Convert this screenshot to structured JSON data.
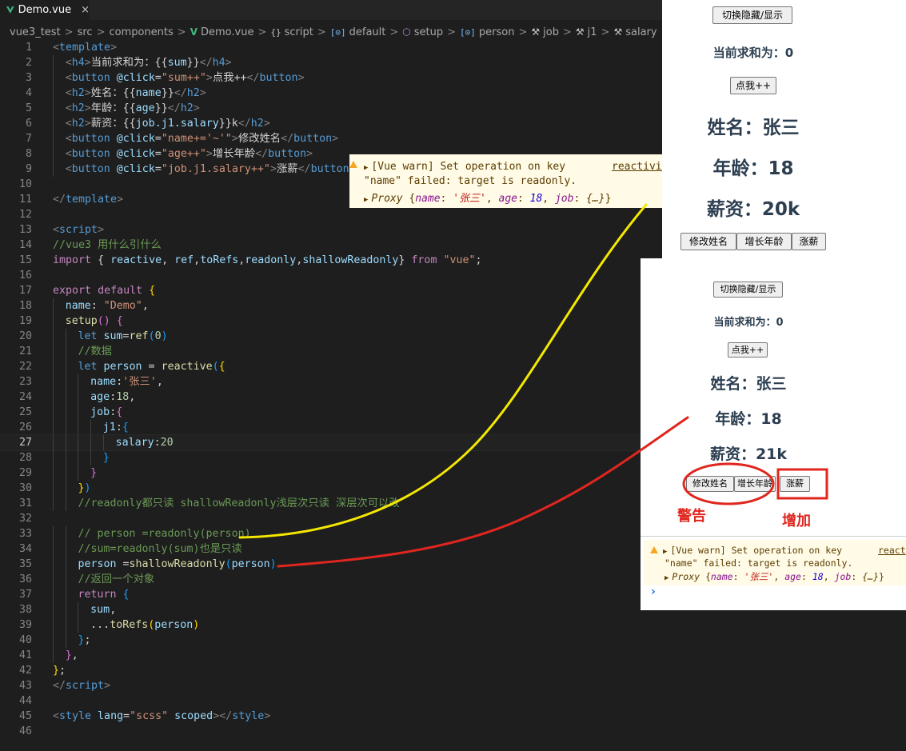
{
  "tab": {
    "label": "Demo.vue",
    "close": "×"
  },
  "breadcrumb": {
    "items": [
      {
        "label": "vue3_test",
        "icon": ""
      },
      {
        "label": "src",
        "icon": ""
      },
      {
        "label": "components",
        "icon": ""
      },
      {
        "label": "Demo.vue",
        "icon": "vue-icon"
      },
      {
        "label": "script",
        "icon": "braces-icon"
      },
      {
        "label": "default",
        "icon": "object-icon"
      },
      {
        "label": "setup",
        "icon": "method-icon"
      },
      {
        "label": "person",
        "icon": "object-icon"
      },
      {
        "label": "job",
        "icon": "wrench-icon"
      },
      {
        "label": "j1",
        "icon": "wrench-icon"
      },
      {
        "label": "salary",
        "icon": "wrench-icon"
      }
    ],
    "separator": ">"
  },
  "editor": {
    "current_line": 27,
    "lines": [
      {
        "n": "1",
        "indent": 1,
        "t": [
          [
            "<",
            "br"
          ],
          [
            "template",
            "tag"
          ],
          [
            ">",
            "br"
          ]
        ]
      },
      {
        "n": "2",
        "indent": 2,
        "t": [
          [
            "<",
            "br"
          ],
          [
            "h4",
            "tag"
          ],
          [
            ">",
            "br"
          ],
          [
            "当前求和为：",
            "txt"
          ],
          [
            "{{",
            "txt"
          ],
          [
            "sum",
            "var"
          ],
          [
            "}}",
            "txt"
          ],
          [
            "</",
            "br"
          ],
          [
            "h4",
            "tag"
          ],
          [
            ">",
            "br"
          ]
        ]
      },
      {
        "n": "3",
        "indent": 2,
        "t": [
          [
            "<",
            "br"
          ],
          [
            "button",
            "tag"
          ],
          [
            " @click",
            "attr"
          ],
          [
            "=",
            "txt"
          ],
          [
            "\"sum++\"",
            "str"
          ],
          [
            ">",
            "br"
          ],
          [
            "点我++",
            "txt"
          ],
          [
            "</",
            "br"
          ],
          [
            "button",
            "tag"
          ],
          [
            ">",
            "br"
          ]
        ]
      },
      {
        "n": "4",
        "indent": 2,
        "t": [
          [
            "<",
            "br"
          ],
          [
            "h2",
            "tag"
          ],
          [
            ">",
            "br"
          ],
          [
            "姓名：",
            "txt"
          ],
          [
            "{{",
            "txt"
          ],
          [
            "name",
            "var"
          ],
          [
            "}}",
            "txt"
          ],
          [
            "</",
            "br"
          ],
          [
            "h2",
            "tag"
          ],
          [
            ">",
            "br"
          ]
        ]
      },
      {
        "n": "5",
        "indent": 2,
        "t": [
          [
            "<",
            "br"
          ],
          [
            "h2",
            "tag"
          ],
          [
            ">",
            "br"
          ],
          [
            "年龄：",
            "txt"
          ],
          [
            "{{",
            "txt"
          ],
          [
            "age",
            "var"
          ],
          [
            "}}",
            "txt"
          ],
          [
            "</",
            "br"
          ],
          [
            "h2",
            "tag"
          ],
          [
            ">",
            "br"
          ]
        ]
      },
      {
        "n": "6",
        "indent": 2,
        "t": [
          [
            "<",
            "br"
          ],
          [
            "h2",
            "tag"
          ],
          [
            ">",
            "br"
          ],
          [
            "薪资：",
            "txt"
          ],
          [
            "{{",
            "txt"
          ],
          [
            "job.j1.salary",
            "var"
          ],
          [
            "}}",
            "txt"
          ],
          [
            "k",
            "txt"
          ],
          [
            "</",
            "br"
          ],
          [
            "h2",
            "tag"
          ],
          [
            ">",
            "br"
          ]
        ]
      },
      {
        "n": "7",
        "indent": 2,
        "t": [
          [
            "<",
            "br"
          ],
          [
            "button",
            "tag"
          ],
          [
            " @click",
            "attr"
          ],
          [
            "=",
            "txt"
          ],
          [
            "\"name+='~'\"",
            "str"
          ],
          [
            ">",
            "br"
          ],
          [
            "修改姓名",
            "txt"
          ],
          [
            "</",
            "br"
          ],
          [
            "button",
            "tag"
          ],
          [
            ">",
            "br"
          ]
        ]
      },
      {
        "n": "8",
        "indent": 2,
        "t": [
          [
            "<",
            "br"
          ],
          [
            "button",
            "tag"
          ],
          [
            " @click",
            "attr"
          ],
          [
            "=",
            "txt"
          ],
          [
            "\"age++\"",
            "str"
          ],
          [
            ">",
            "br"
          ],
          [
            "增长年龄",
            "txt"
          ],
          [
            "</",
            "br"
          ],
          [
            "button",
            "tag"
          ],
          [
            ">",
            "br"
          ]
        ]
      },
      {
        "n": "9",
        "indent": 2,
        "t": [
          [
            "<",
            "br"
          ],
          [
            "button",
            "tag"
          ],
          [
            " @click",
            "attr"
          ],
          [
            "=",
            "txt"
          ],
          [
            "\"job.j1.salary++\"",
            "str"
          ],
          [
            ">",
            "br"
          ],
          [
            "涨薪",
            "txt"
          ],
          [
            "</",
            "br"
          ],
          [
            "button",
            "tag"
          ],
          [
            ">",
            "br"
          ]
        ]
      },
      {
        "n": "10",
        "indent": 0,
        "t": []
      },
      {
        "n": "11",
        "indent": 1,
        "t": [
          [
            "</",
            "br"
          ],
          [
            "template",
            "tag"
          ],
          [
            ">",
            "br"
          ]
        ]
      },
      {
        "n": "12",
        "indent": 0,
        "t": []
      },
      {
        "n": "13",
        "indent": 1,
        "t": [
          [
            "<",
            "br"
          ],
          [
            "script",
            "tag"
          ],
          [
            ">",
            "br"
          ]
        ]
      },
      {
        "n": "14",
        "indent": 1,
        "t": [
          [
            "//vue3 用什么引什么",
            "com"
          ]
        ]
      },
      {
        "n": "15",
        "indent": 1,
        "t": [
          [
            "import",
            "kw"
          ],
          [
            " { ",
            "txt"
          ],
          [
            "reactive",
            "var"
          ],
          [
            ", ",
            "txt"
          ],
          [
            "ref",
            "var"
          ],
          [
            ",",
            "txt"
          ],
          [
            "toRefs",
            "var"
          ],
          [
            ",",
            "txt"
          ],
          [
            "readonly",
            "var"
          ],
          [
            ",",
            "txt"
          ],
          [
            "shallowReadonly",
            "var"
          ],
          [
            "} ",
            "txt"
          ],
          [
            "from",
            "kw"
          ],
          [
            " ",
            "txt"
          ],
          [
            "\"vue\"",
            "str"
          ],
          [
            ";",
            "txt"
          ]
        ]
      },
      {
        "n": "16",
        "indent": 0,
        "t": []
      },
      {
        "n": "17",
        "indent": 1,
        "t": [
          [
            "export",
            "kw"
          ],
          [
            " ",
            "txt"
          ],
          [
            "default",
            "kw"
          ],
          [
            " ",
            "txt"
          ],
          [
            "{",
            "y"
          ]
        ]
      },
      {
        "n": "18",
        "indent": 2,
        "t": [
          [
            "name",
            "var"
          ],
          [
            ": ",
            "txt"
          ],
          [
            "\"Demo\"",
            "str"
          ],
          [
            ",",
            "txt"
          ]
        ]
      },
      {
        "n": "19",
        "indent": 2,
        "t": [
          [
            "setup",
            "fn"
          ],
          [
            "() ",
            "p"
          ],
          [
            "{",
            "p"
          ]
        ]
      },
      {
        "n": "20",
        "indent": 3,
        "t": [
          [
            "let",
            "kw2"
          ],
          [
            " ",
            "txt"
          ],
          [
            "sum",
            "var"
          ],
          [
            "=",
            "txt"
          ],
          [
            "ref",
            "fn"
          ],
          [
            "(",
            "b"
          ],
          [
            "0",
            "num"
          ],
          [
            ")",
            "b"
          ]
        ]
      },
      {
        "n": "21",
        "indent": 3,
        "t": [
          [
            "//数据",
            "com"
          ]
        ]
      },
      {
        "n": "22",
        "indent": 3,
        "t": [
          [
            "let",
            "kw2"
          ],
          [
            " ",
            "txt"
          ],
          [
            "person",
            "var"
          ],
          [
            " = ",
            "txt"
          ],
          [
            "reactive",
            "fn"
          ],
          [
            "(",
            "b"
          ],
          [
            "{",
            "y"
          ]
        ]
      },
      {
        "n": "23",
        "indent": 4,
        "t": [
          [
            "name",
            "var"
          ],
          [
            ":",
            "txt"
          ],
          [
            "'张三'",
            "str"
          ],
          [
            ",",
            "txt"
          ]
        ]
      },
      {
        "n": "24",
        "indent": 4,
        "t": [
          [
            "age",
            "var"
          ],
          [
            ":",
            "txt"
          ],
          [
            "18",
            "num"
          ],
          [
            ",",
            "txt"
          ]
        ]
      },
      {
        "n": "25",
        "indent": 4,
        "t": [
          [
            "job",
            "var"
          ],
          [
            ":",
            "txt"
          ],
          [
            "{",
            "p"
          ]
        ]
      },
      {
        "n": "26",
        "indent": 5,
        "t": [
          [
            "j1",
            "var"
          ],
          [
            ":",
            "txt"
          ],
          [
            "{",
            "b"
          ]
        ]
      },
      {
        "n": "27",
        "indent": 6,
        "t": [
          [
            "salary",
            "var"
          ],
          [
            ":",
            "txt"
          ],
          [
            "20",
            "num"
          ]
        ]
      },
      {
        "n": "28",
        "indent": 5,
        "t": [
          [
            "}",
            "b"
          ]
        ]
      },
      {
        "n": "29",
        "indent": 4,
        "t": [
          [
            "}",
            "p"
          ]
        ]
      },
      {
        "n": "30",
        "indent": 3,
        "t": [
          [
            "}",
            "y"
          ],
          [
            ")",
            "b"
          ]
        ]
      },
      {
        "n": "31",
        "indent": 3,
        "t": [
          [
            "//readonly都只读 shallowReadonly浅层次只读 深层次可以改",
            "com"
          ]
        ]
      },
      {
        "n": "32",
        "indent": 0,
        "t": []
      },
      {
        "n": "33",
        "indent": 3,
        "t": [
          [
            "// person =readonly(person)",
            "com"
          ]
        ]
      },
      {
        "n": "34",
        "indent": 3,
        "t": [
          [
            "//sum=readonly(sum)也是只读",
            "com"
          ]
        ]
      },
      {
        "n": "35",
        "indent": 3,
        "t": [
          [
            "person",
            "var"
          ],
          [
            " =",
            "txt"
          ],
          [
            "shallowReadonly",
            "fn"
          ],
          [
            "(",
            "b"
          ],
          [
            "person",
            "var"
          ],
          [
            ")",
            "b"
          ]
        ]
      },
      {
        "n": "36",
        "indent": 3,
        "t": [
          [
            "//返回一个对象",
            "com"
          ]
        ]
      },
      {
        "n": "37",
        "indent": 3,
        "t": [
          [
            "return",
            "kw"
          ],
          [
            " ",
            "txt"
          ],
          [
            "{",
            "b"
          ]
        ]
      },
      {
        "n": "38",
        "indent": 4,
        "t": [
          [
            "sum",
            "var"
          ],
          [
            ",",
            "txt"
          ]
        ]
      },
      {
        "n": "39",
        "indent": 4,
        "t": [
          [
            "...",
            "txt"
          ],
          [
            "toRefs",
            "fn"
          ],
          [
            "(",
            "y"
          ],
          [
            "person",
            "var"
          ],
          [
            ")",
            "y"
          ]
        ]
      },
      {
        "n": "40",
        "indent": 3,
        "t": [
          [
            "}",
            "b"
          ],
          [
            ";",
            "txt"
          ]
        ]
      },
      {
        "n": "41",
        "indent": 2,
        "t": [
          [
            "}",
            "p"
          ],
          [
            ",",
            "txt"
          ]
        ]
      },
      {
        "n": "42",
        "indent": 1,
        "t": [
          [
            "}",
            "y"
          ],
          [
            ";",
            "txt"
          ]
        ]
      },
      {
        "n": "43",
        "indent": 1,
        "t": [
          [
            "</",
            "br"
          ],
          [
            "script",
            "tag"
          ],
          [
            ">",
            "br"
          ]
        ]
      },
      {
        "n": "44",
        "indent": 0,
        "t": []
      },
      {
        "n": "45",
        "indent": 1,
        "t": [
          [
            "<",
            "br"
          ],
          [
            "style",
            "tag"
          ],
          [
            " lang",
            "attr"
          ],
          [
            "=",
            "txt"
          ],
          [
            "\"scss\"",
            "str"
          ],
          [
            " scoped",
            "attr"
          ],
          [
            ">",
            "br"
          ],
          [
            "</",
            "br"
          ],
          [
            "style",
            "tag"
          ],
          [
            ">",
            "br"
          ]
        ]
      },
      {
        "n": "46",
        "indent": 0,
        "t": []
      }
    ]
  },
  "warning_top": {
    "line1": "[Vue warn] Set operation on key",
    "link": "reactivity.e",
    "line2": "\"name\" failed: target is readonly.",
    "proxy_prefix": "Proxy",
    "proxy_k1": "name",
    "proxy_v1": "'张三'",
    "proxy_k2": "age",
    "proxy_v2": "18",
    "proxy_k3": "job",
    "proxy_v3": "{…}"
  },
  "warning_bottom": {
    "line1": "[Vue warn] Set operation on key",
    "link": "react",
    "line2": "\"name\" failed: target is readonly.",
    "proxy_prefix": "Proxy",
    "proxy_k1": "name",
    "proxy_v1": "'张三'",
    "proxy_k2": "age",
    "proxy_v2": "18",
    "proxy_k3": "job",
    "proxy_v3": "{…}",
    "prompt": "›"
  },
  "app_top": {
    "toggle_button": "切换隐藏/显示",
    "sum_heading": "当前求和为：0",
    "click_button": "点我++",
    "name_heading": "姓名：张三",
    "age_heading": "年龄：18",
    "salary_heading": "薪资：20k",
    "rename_button": "修改姓名",
    "age_button": "增长年龄",
    "raise_button": "涨薪"
  },
  "app_bottom": {
    "toggle_button": "切换隐藏/显示",
    "sum_heading": "当前求和为：0",
    "click_button": "点我++",
    "name_heading": "姓名：张三",
    "age_heading": "年龄：18",
    "salary_heading": "薪资：21k",
    "rename_button": "修改姓名",
    "age_button": "增长年龄",
    "raise_button": "涨薪"
  },
  "annotations": {
    "warn_label": "警告",
    "increase_label": "增加"
  },
  "colors": {
    "yellow_stroke": "#f5e800",
    "red_stroke": "#e0261e",
    "editor_bg": "#1e1e1e"
  }
}
